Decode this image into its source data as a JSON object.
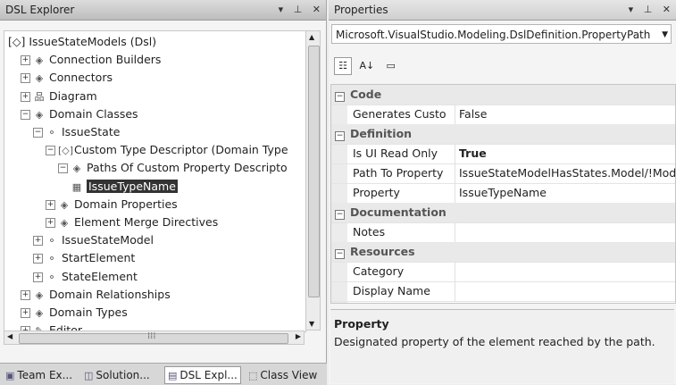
{
  "left_panel": {
    "title": "DSL Explorer",
    "tree": [
      {
        "label": "[◇] IssueStateModels (Dsl)",
        "icon": "dsl-root-icon",
        "level": 0,
        "expander": ""
      },
      {
        "label": "Connection Builders",
        "icon": "domain-class-icon",
        "level": 1,
        "expander": "+"
      },
      {
        "label": "Connectors",
        "icon": "domain-class-icon",
        "level": 1,
        "expander": "+"
      },
      {
        "label": "Diagram",
        "icon": "diagram-icon",
        "level": 1,
        "expander": "+"
      },
      {
        "label": "Domain Classes",
        "icon": "domain-class-icon",
        "level": 1,
        "expander": "-"
      },
      {
        "label": "IssueState",
        "icon": "class-icon",
        "level": 2,
        "expander": "-"
      },
      {
        "label": "Custom Type Descriptor (Domain Type",
        "icon": "type-descriptor-icon",
        "level": 3,
        "expander": "-"
      },
      {
        "label": "Paths Of Custom Property Descripto",
        "icon": "domain-class-icon",
        "level": 4,
        "expander": "-"
      },
      {
        "label": "IssueTypeName",
        "icon": "property-path-icon",
        "level": 5,
        "expander": "",
        "selected": true
      },
      {
        "label": "Domain Properties",
        "icon": "domain-class-icon",
        "level": 3,
        "expander": "+"
      },
      {
        "label": "Element Merge Directives",
        "icon": "domain-class-icon",
        "level": 3,
        "expander": "+"
      },
      {
        "label": "IssueStateModel",
        "icon": "class-icon",
        "level": 2,
        "expander": "+"
      },
      {
        "label": "StartElement",
        "icon": "class-icon",
        "level": 2,
        "expander": "+"
      },
      {
        "label": "StateElement",
        "icon": "class-icon",
        "level": 2,
        "expander": "+"
      },
      {
        "label": "Domain Relationships",
        "icon": "domain-class-icon",
        "level": 1,
        "expander": "+"
      },
      {
        "label": "Domain Types",
        "icon": "domain-class-icon",
        "level": 1,
        "expander": "+"
      },
      {
        "label": "Editor",
        "icon": "editor-icon",
        "level": 1,
        "expander": "+"
      }
    ],
    "tabs": [
      {
        "label": "Team Ex...",
        "icon": "team-explorer-icon"
      },
      {
        "label": "Solution...",
        "icon": "solution-explorer-icon"
      },
      {
        "label": "DSL Expl...",
        "icon": "dsl-explorer-icon",
        "active": true
      },
      {
        "label": "Class View",
        "icon": "class-view-icon"
      }
    ]
  },
  "right_panel": {
    "title": "Properties",
    "object_selector": "Microsoft.VisualStudio.Modeling.DslDefinition.PropertyPath",
    "rows": [
      {
        "type": "category",
        "label": "Code"
      },
      {
        "type": "prop",
        "name": "Generates Custom",
        "value": "False"
      },
      {
        "type": "category",
        "label": "Definition"
      },
      {
        "type": "prop",
        "name": "Is UI Read Only",
        "value": "True",
        "bold": true
      },
      {
        "type": "prop",
        "name": "Path To Property",
        "value": "IssueStateModelHasStates.Model/!Model"
      },
      {
        "type": "prop",
        "name": "Property",
        "value": "IssueTypeName"
      },
      {
        "type": "category",
        "label": "Documentation"
      },
      {
        "type": "prop",
        "name": "Notes",
        "value": ""
      },
      {
        "type": "category",
        "label": "Resources"
      },
      {
        "type": "prop",
        "name": "Category",
        "value": ""
      },
      {
        "type": "prop",
        "name": "Display Name",
        "value": ""
      }
    ],
    "description_title": "Property",
    "description_text": "Designated property of the element reached by the path."
  }
}
